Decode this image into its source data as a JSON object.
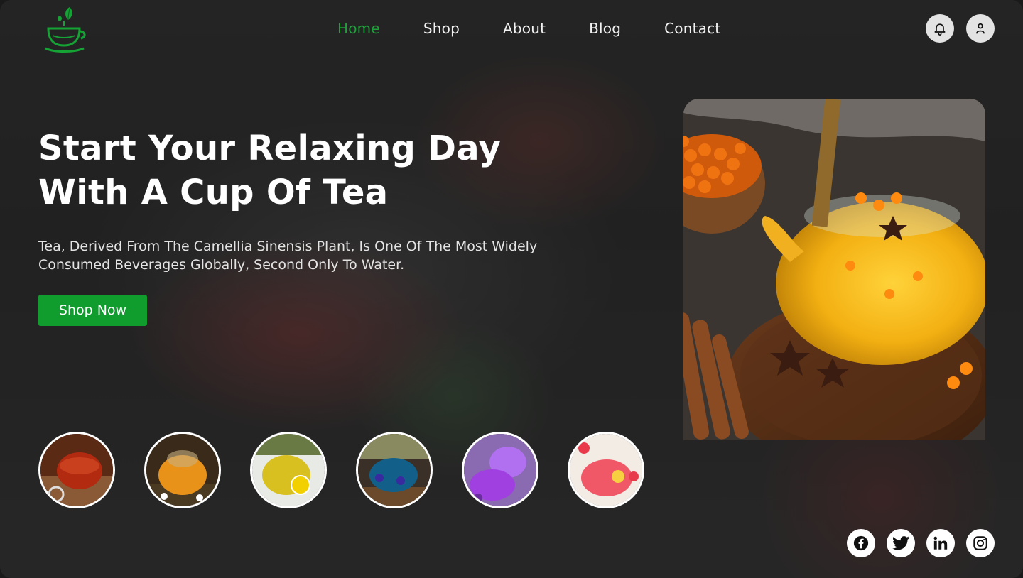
{
  "brand": {
    "logo_icon": "tea-cup-leaf-logo",
    "accent": "#1ea13a"
  },
  "nav": {
    "items": [
      {
        "label": "Home",
        "active": true
      },
      {
        "label": "Shop",
        "active": false
      },
      {
        "label": "About",
        "active": false
      },
      {
        "label": "Blog",
        "active": false
      },
      {
        "label": "Contact",
        "active": false
      }
    ]
  },
  "header_actions": {
    "notifications_icon": "bell-icon",
    "profile_icon": "user-icon"
  },
  "hero": {
    "title_line1": "Start Your Relaxing Day",
    "title_line2": "With A Cup Of Tea",
    "description": "Tea, Derived From The Camellia Sinensis Plant, Is One Of The Most Widely Consumed Beverages Globally, Second Only To Water.",
    "cta_label": "Shop Now",
    "cta_color": "#119c2e"
  },
  "featured_image": {
    "subject": "glass teapot with sea buckthorn tea on wooden board"
  },
  "thumbnails": [
    {
      "subject": "red tea teapot"
    },
    {
      "subject": "amber tea teapot with chamomile"
    },
    {
      "subject": "yellow lemon tea teapot"
    },
    {
      "subject": "blue butterfly pea tea teapot"
    },
    {
      "subject": "purple tea cups"
    },
    {
      "subject": "berry tea teapot"
    }
  ],
  "socials": [
    {
      "icon": "facebook-icon"
    },
    {
      "icon": "twitter-icon"
    },
    {
      "icon": "linkedin-icon"
    },
    {
      "icon": "instagram-icon"
    }
  ]
}
